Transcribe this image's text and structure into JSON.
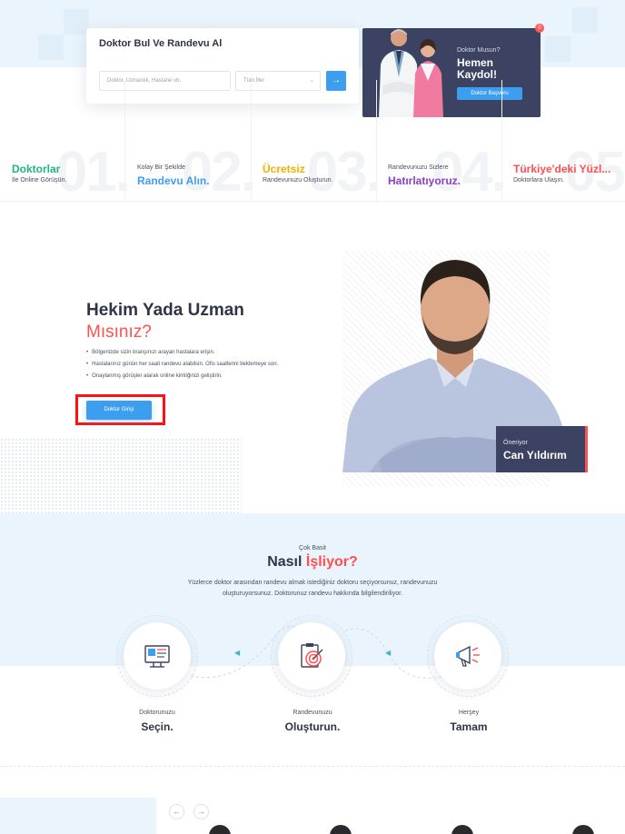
{
  "search": {
    "title": "Doktor Bul Ve Randevu Al",
    "placeholder": "Doktor, Uzmanlık, Hastane vb.",
    "city_select": "Tüm İller",
    "submit_icon": "arrow-right-icon"
  },
  "register": {
    "question": "Doktor Musun?",
    "headline": "Hemen Kaydol!",
    "button": "Doktor Başvuru",
    "badge": "0"
  },
  "features": [
    {
      "num": "01.",
      "first": "Doktorlar",
      "second": "İle Online Görüşün.",
      "order": "big-first",
      "color": "#1fb389"
    },
    {
      "num": "02.",
      "first": "Kolay Bir Şekilde",
      "second": "Randevu Alın.",
      "order": "small-first",
      "color": "#3d9ef0"
    },
    {
      "num": "03.",
      "first": "Ücretsiz",
      "second": "Randevunuzu Oluşturun.",
      "order": "big-first",
      "color": "#f2b100"
    },
    {
      "num": "04.",
      "first": "Randevunuzu Sizlere",
      "second": "Hatırlatıyoruz.",
      "order": "small-first",
      "color": "#8a3fc8"
    },
    {
      "num": "05.",
      "first": "Türkiye'deki Yüzl...",
      "second": "Doktorlara Ulaşın.",
      "order": "big-first",
      "color": "#ff4f4f"
    }
  ],
  "hekim": {
    "title": "Hekim Yada Uzman",
    "subtitle": "Mısınız?",
    "bullets": [
      "Bölgenizde sizin branşınızı arayan hastalara erişin.",
      "Hastalarınız günün her saati randevu alabilsin. Ofis saatlerini beklemeye son.",
      "Onaylanmış görüşler alarak online kimliğinizi geliştirin."
    ],
    "button": "Doktor Girişi"
  },
  "recommend": {
    "label": "Öneriyor",
    "name": "Can Yıldırım"
  },
  "how": {
    "small": "Çok Basit",
    "title_a": "Nasıl",
    "title_b": "İşliyor?",
    "desc": "Yüzlerce doktor arasından randevu almak istediğiniz doktoru seçiyorsunuz, randevunuzu oluşturuyorsunuz. Doktorunuz randevu hakkında bilgilendiriliyor.",
    "steps": [
      {
        "small": "Doktorunuzu",
        "big": "Seçin.",
        "icon": "doctor-profile-icon"
      },
      {
        "small": "Randevunuzu",
        "big": "Oluşturun.",
        "icon": "clipboard-target-icon"
      },
      {
        "small": "Herşey",
        "big": "Tamam",
        "icon": "megaphone-icon"
      }
    ]
  },
  "carousel": {
    "prev": "←",
    "next": "→"
  }
}
